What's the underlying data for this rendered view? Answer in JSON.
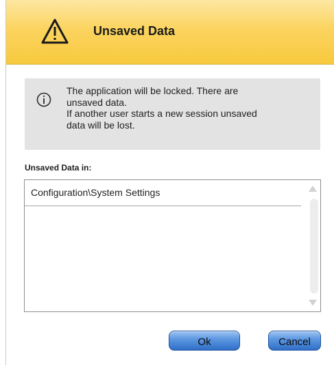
{
  "dialog": {
    "title": "Unsaved Data",
    "info_line1": "The application will be locked. There are",
    "info_line2": "unsaved data.",
    "info_line3": "If another user starts a new session unsaved",
    "info_line4": "data will be lost.",
    "list_label": "Unsaved Data in:",
    "list_items": [
      "Configuration\\System Settings"
    ],
    "ok_label": "Ok",
    "cancel_label": "Cancel"
  },
  "icons": {
    "title_icon": "warning-icon",
    "info_icon": "info-icon"
  },
  "colors": {
    "titlebar": "#f8c93e",
    "info_background": "#e3e3e3",
    "button_blue": "#2f6fc8"
  }
}
